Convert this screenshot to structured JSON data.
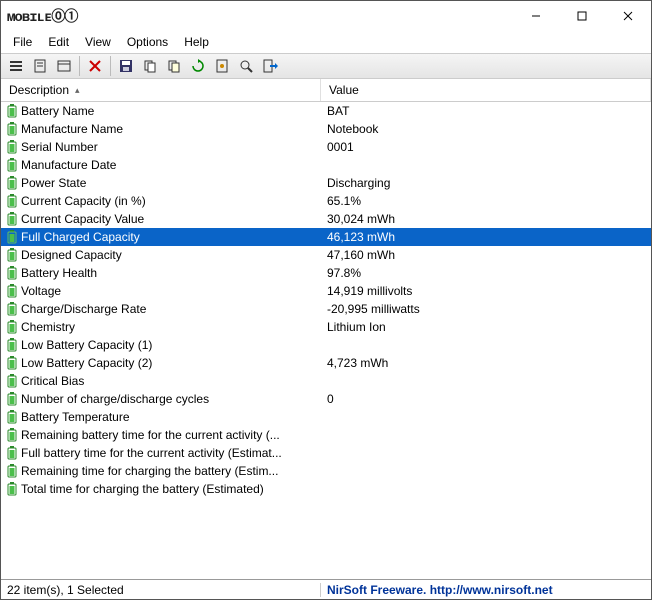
{
  "title": "MOBILE01",
  "menu": [
    "File",
    "Edit",
    "View",
    "Options",
    "Help"
  ],
  "columns": {
    "desc": "Description",
    "val": "Value"
  },
  "rows": [
    {
      "desc": "Battery Name",
      "val": "BAT"
    },
    {
      "desc": "Manufacture Name",
      "val": "Notebook"
    },
    {
      "desc": "Serial Number",
      "val": "0001"
    },
    {
      "desc": "Manufacture Date",
      "val": ""
    },
    {
      "desc": "Power State",
      "val": "Discharging"
    },
    {
      "desc": "Current Capacity (in %)",
      "val": "65.1%"
    },
    {
      "desc": "Current Capacity Value",
      "val": "30,024 mWh"
    },
    {
      "desc": "Full Charged Capacity",
      "val": "46,123 mWh",
      "selected": true
    },
    {
      "desc": "Designed Capacity",
      "val": "47,160 mWh"
    },
    {
      "desc": "Battery Health",
      "val": "97.8%"
    },
    {
      "desc": "Voltage",
      "val": "14,919 millivolts"
    },
    {
      "desc": "Charge/Discharge Rate",
      "val": "-20,995 milliwatts"
    },
    {
      "desc": "Chemistry",
      "val": "Lithium Ion"
    },
    {
      "desc": "Low Battery Capacity (1)",
      "val": ""
    },
    {
      "desc": "Low Battery Capacity (2)",
      "val": "4,723 mWh"
    },
    {
      "desc": "Critical Bias",
      "val": ""
    },
    {
      "desc": "Number of charge/discharge cycles",
      "val": "0"
    },
    {
      "desc": "Battery Temperature",
      "val": ""
    },
    {
      "desc": "Remaining battery time for the current activity (...",
      "val": ""
    },
    {
      "desc": "Full battery time for the current activity (Estimat...",
      "val": ""
    },
    {
      "desc": "Remaining time for charging the battery (Estim...",
      "val": ""
    },
    {
      "desc": "Total  time for charging the battery (Estimated)",
      "val": ""
    }
  ],
  "status": {
    "left": "22 item(s), 1 Selected",
    "right": "NirSoft Freeware.  http://www.nirsoft.net"
  },
  "toolbar_icons": [
    "list-icon",
    "report-icon",
    "properties-icon",
    "delete-icon",
    "save-icon",
    "copy-icon",
    "copy2-icon",
    "refresh-icon",
    "options-icon",
    "find-icon",
    "exit-icon"
  ]
}
